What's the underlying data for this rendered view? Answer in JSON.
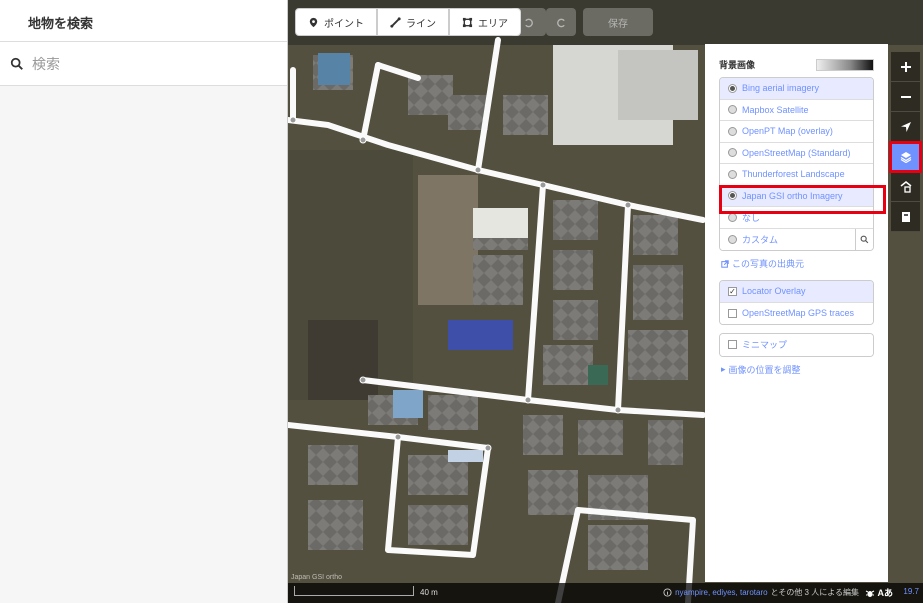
{
  "sidebar": {
    "title": "地物を検索",
    "search_placeholder": "検索"
  },
  "toolbar": {
    "point_label": "ポイント",
    "line_label": "ライン",
    "area_label": "エリア",
    "save_label": "保存"
  },
  "background_panel": {
    "title": "背景画像",
    "layers": [
      {
        "label": "Bing aerial imagery",
        "selected": false
      },
      {
        "label": "Mapbox Satellite",
        "selected": false
      },
      {
        "label": "OpenPT Map (overlay)",
        "selected": false
      },
      {
        "label": "OpenStreetMap (Standard)",
        "selected": false
      },
      {
        "label": "Thunderforest Landscape",
        "selected": false
      },
      {
        "label": "Japan GSI ortho Imagery",
        "selected": true
      },
      {
        "label": "なし",
        "selected": false
      },
      {
        "label": "カスタム",
        "selected": false
      }
    ],
    "source_link": "この写真の出典元",
    "overlays": [
      {
        "label": "Locator Overlay",
        "checked": true
      },
      {
        "label": "OpenStreetMap GPS traces",
        "checked": false
      }
    ],
    "minimap_label": "ミニマップ",
    "offset_link": "画像の位置を調整"
  },
  "footer": {
    "scale_label": "40 m",
    "imagery_caption": "Japan GSI ortho",
    "users": "nyampire, ediyes, tarotaro",
    "attribution_suffix": "とその他 3 人による編集",
    "issues_label": "Aあ",
    "version": "19.7"
  },
  "colors": {
    "accent": "#7092ff",
    "highlight": "#e60012"
  }
}
